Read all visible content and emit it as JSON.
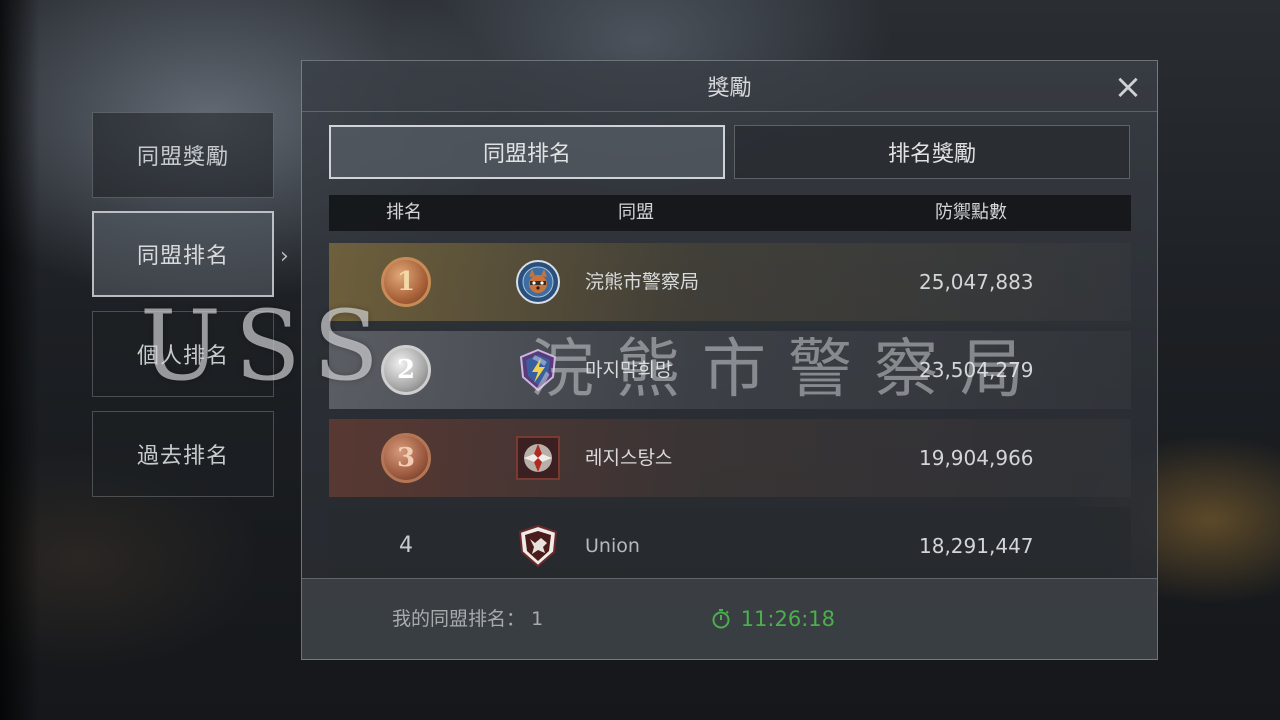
{
  "side_tabs": [
    {
      "label": "同盟獎勵",
      "active": false
    },
    {
      "label": "同盟排名",
      "active": true
    },
    {
      "label": "個人排名",
      "active": false
    },
    {
      "label": "過去排名",
      "active": false
    }
  ],
  "panel": {
    "title": "獎勵",
    "close_icon": "×",
    "tabs": [
      {
        "label": "同盟排名",
        "active": true
      },
      {
        "label": "排名獎勵",
        "active": false
      }
    ],
    "columns": {
      "rank": "排名",
      "alliance": "同盟",
      "points": "防禦點數"
    },
    "rows": [
      {
        "rank": "1",
        "medal": "gold",
        "emblem": "raccoon-badge-icon",
        "name": "浣熊市警察局",
        "points": "25,047,883"
      },
      {
        "rank": "2",
        "medal": "silver",
        "emblem": "lightning-shield-icon",
        "name": "마지막희망",
        "points": "23,504,279"
      },
      {
        "rank": "3",
        "medal": "bronze",
        "emblem": "umbrella-crest-icon",
        "name": "레지스탕스",
        "points": "19,904,966"
      },
      {
        "rank": "4",
        "medal": null,
        "emblem": "wolf-shield-icon",
        "name": "Union",
        "points": "18,291,447"
      }
    ],
    "footer": {
      "my_rank_label": "我的同盟排名：",
      "my_rank_value": "1",
      "timer_icon": "stopwatch-icon",
      "timer": "11:26:18"
    }
  },
  "watermark": {
    "text": "USS",
    "cjk_text": "浣熊市警察局"
  },
  "colors": {
    "timer_green": "#4cae4c",
    "gold_medal": "#c98b55",
    "silver_medal": "#cfcfcf",
    "bronze_medal": "#b57656"
  }
}
